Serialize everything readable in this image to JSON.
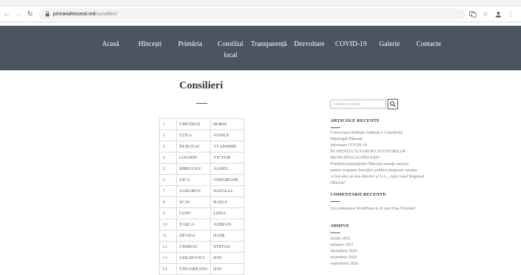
{
  "browser": {
    "url_host": "primariahincesti.md",
    "url_path": "/consilieri/"
  },
  "menu": [
    {
      "label": "Acasă"
    },
    {
      "label": "Hîncești"
    },
    {
      "label": "Primăria"
    },
    {
      "label": "Consiliul local"
    },
    {
      "label": "Transparență"
    },
    {
      "label": "Dezvoltare"
    },
    {
      "label": "COVID-19"
    },
    {
      "label": "Galerie"
    },
    {
      "label": "Contacte"
    }
  ],
  "page": {
    "title": "Consilieri"
  },
  "councillors": [
    {
      "n": "1",
      "last": "CHETRUȘ",
      "first": "BORIS"
    },
    {
      "n": "2",
      "last": "COȚA",
      "first": "VASILE"
    },
    {
      "n": "3",
      "last": "BUȘCEAC",
      "first": "VLADIMIR"
    },
    {
      "n": "4",
      "last": "LOGHIN",
      "first": "VICTOR"
    },
    {
      "n": "5",
      "last": "BIRIUCOV",
      "first": "AUREL"
    },
    {
      "n": "6",
      "last": "LICA",
      "first": "GHEORGHE"
    },
    {
      "n": "7",
      "last": "SAHAROV",
      "first": "NATALIA"
    },
    {
      "n": "8",
      "last": "SCAI",
      "first": "RAISA"
    },
    {
      "n": "9",
      "last": "LUPU",
      "first": "LIDIA"
    },
    {
      "n": "10",
      "last": "ȚAȘCA",
      "first": "ADRIAN"
    },
    {
      "n": "11",
      "last": "DIVIZA",
      "first": "IGOR"
    },
    {
      "n": "12",
      "last": "CHIRIAC",
      "first": "ȘTEFAN"
    },
    {
      "n": "13",
      "last": "UDLDOVICI",
      "first": "ION"
    },
    {
      "n": "14",
      "last": "UNGUREANU",
      "first": "ION"
    }
  ],
  "sidebar": {
    "search_placeholder": "Căutare prin site",
    "recent_articles_title": "ARTICOLE RECENTE",
    "recent_articles": [
      "Convocarea Ședinței ordinare a Consiliului",
      "Municipal Hîncești",
      "Informare COVID-19",
      "ÎN ATENȚIA TUTUROR LOCUITORILOR",
      "MUNICIPIULUI HÎNCEȘTI.",
      "Primăria municipiului Hîncești anunță concurs",
      "pentru ocuparea funcțiilor publice temporar vacante",
      "A fost ales un nou director al S.A. „Apă Canal Regional",
      "Hîncești”"
    ],
    "recent_comments_title": "COMENTARII RECENTE",
    "recent_comment": "Un comentator WordPress la Și mai Ziua Victoriei!",
    "archive_title": "ARHIVE",
    "archive": [
      "martie 2021",
      "ianuarie 2021",
      "decembrie 2020",
      "noiembrie 2020",
      "septembrie 2020"
    ]
  }
}
